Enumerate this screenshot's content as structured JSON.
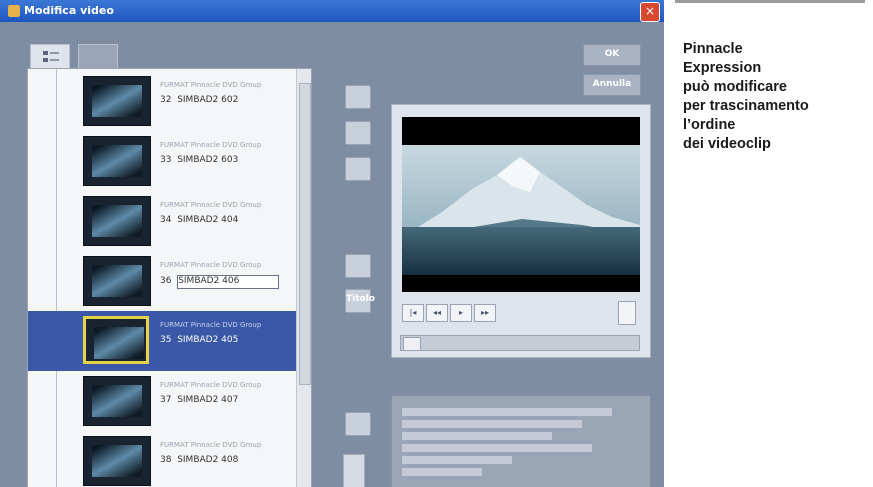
{
  "window": {
    "title": "Modifica video",
    "close_glyph": "×"
  },
  "dialog_buttons": {
    "ok": "OK",
    "cancel": "Annulla"
  },
  "view_tabs": [
    {
      "icon": "storyboard-view-icon",
      "selected": true
    },
    {
      "icon": "timeline-view-icon",
      "selected": false
    }
  ],
  "clips": [
    {
      "type": "FURMAT Pinnacle DVD Group",
      "number": "32",
      "name": "SIMBAD2 602",
      "selected": false
    },
    {
      "type": "FURMAT Pinnacle DVD Group",
      "number": "33",
      "name": "SIMBAD2 603",
      "selected": false
    },
    {
      "type": "FURMAT Pinnacle DVD Group",
      "number": "34",
      "name": "SIMBAD2 404",
      "selected": false
    },
    {
      "type": "FURMAT Pinnacle DVD Group",
      "number": "36",
      "name": "SIMBAD2 406",
      "selected": false,
      "editing": true
    },
    {
      "type": "FURMAT Pinnacle DVD Group",
      "number": "35",
      "name": "SIMBAD2 405",
      "selected": true
    },
    {
      "type": "FURMAT Pinnacle DVD Group",
      "number": "37",
      "name": "SIMBAD2 407",
      "selected": false
    },
    {
      "type": "FURMAT Pinnacle DVD Group",
      "number": "38",
      "name": "SIMBAD2 408",
      "selected": false
    }
  ],
  "side_tools": [
    {
      "icon": "split-clip-icon"
    },
    {
      "icon": "combine-clips-icon"
    },
    {
      "icon": "trim-icon"
    },
    {
      "icon": "effects-icon"
    },
    {
      "icon": "title-text-icon",
      "label": "Titolo"
    },
    {
      "icon": "properties-icon"
    },
    {
      "icon": "trash-icon"
    }
  ],
  "transport": [
    "|◂",
    "◂◂",
    "▸",
    "▸▸"
  ],
  "colors": {
    "window_bg": "#7f8da3",
    "selection": "#3a57a8",
    "selection_border": "#e8d24a",
    "titlebar": "#2f6ad0"
  },
  "caption": {
    "text": "Pinnacle\nExpression\npuò modificare\nper trascinamento\nl’ordine\ndei videoclip"
  }
}
